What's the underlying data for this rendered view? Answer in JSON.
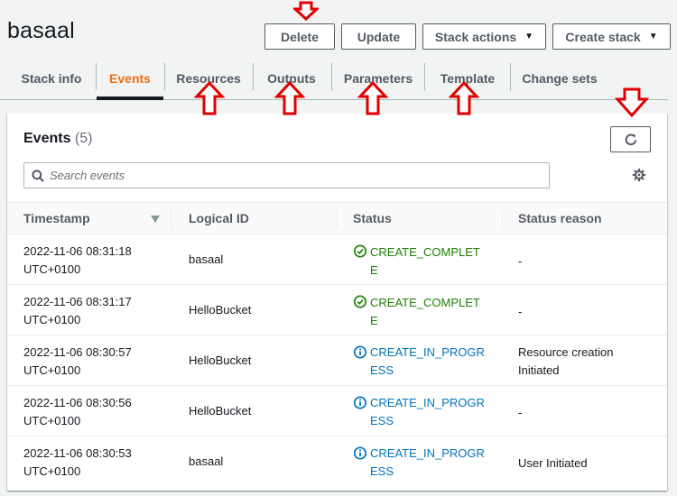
{
  "header": {
    "title": "basaal",
    "buttons": {
      "delete": "Delete",
      "update": "Update",
      "stack_actions": "Stack actions",
      "create_stack": "Create stack"
    }
  },
  "tabs": [
    {
      "label": "Stack info",
      "active": false
    },
    {
      "label": "Events",
      "active": true
    },
    {
      "label": "Resources",
      "active": false
    },
    {
      "label": "Outputs",
      "active": false
    },
    {
      "label": "Parameters",
      "active": false
    },
    {
      "label": "Template",
      "active": false
    },
    {
      "label": "Change sets",
      "active": false
    }
  ],
  "events": {
    "title": "Events",
    "count": "(5)",
    "search_placeholder": "Search events",
    "columns": [
      "Timestamp",
      "Logical ID",
      "Status",
      "Status reason"
    ],
    "rows": [
      {
        "ts1": "2022-11-06 08:31:18",
        "ts2": "UTC+0100",
        "logical_id": "basaal",
        "status": "CREATE_COMPLETE",
        "status_type": "complete",
        "reason": "-"
      },
      {
        "ts1": "2022-11-06 08:31:17",
        "ts2": "UTC+0100",
        "logical_id": "HelloBucket",
        "status": "CREATE_COMPLETE",
        "status_type": "complete",
        "reason": "-"
      },
      {
        "ts1": "2022-11-06 08:30:57",
        "ts2": "UTC+0100",
        "logical_id": "HelloBucket",
        "status": "CREATE_IN_PROGRESS",
        "status_type": "progress",
        "reason": "Resource creation Initiated"
      },
      {
        "ts1": "2022-11-06 08:30:56",
        "ts2": "UTC+0100",
        "logical_id": "HelloBucket",
        "status": "CREATE_IN_PROGRESS",
        "status_type": "progress",
        "reason": "-"
      },
      {
        "ts1": "2022-11-06 08:30:53",
        "ts2": "UTC+0100",
        "logical_id": "basaal",
        "status": "CREATE_IN_PROGRESS",
        "status_type": "progress",
        "reason": "User Initiated"
      }
    ]
  },
  "icons": {
    "search": "search-icon",
    "refresh": "refresh-icon",
    "settings": "gear-icon",
    "complete": "check-circle-icon",
    "progress": "info-circle-icon",
    "sort": "caret-down-icon",
    "annotation": "red-arrow-icon"
  },
  "colors": {
    "active_tab": "#ec7211",
    "success": "#1d8102",
    "in_progress": "#0073bb",
    "annotation_arrow": "#e00000"
  }
}
